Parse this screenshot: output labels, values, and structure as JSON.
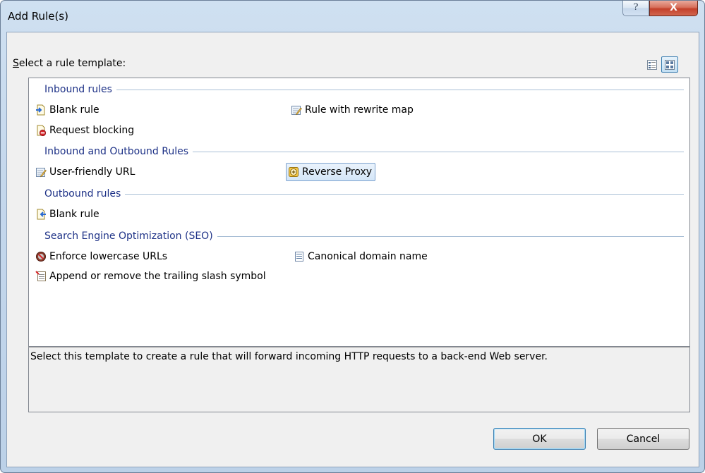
{
  "window": {
    "title": "Add Rule(s)",
    "help_glyph": "?",
    "close_glyph": "X"
  },
  "template_picker": {
    "label_underlined": "S",
    "label_rest": "elect a rule template:",
    "view_modes": [
      "details-view-icon",
      "tiles-view-icon"
    ],
    "active_view": "tiles-view-icon"
  },
  "groups": [
    {
      "header": "Inbound rules",
      "items": [
        {
          "label": "Blank rule",
          "icon": "inbound-blank-rule-icon"
        },
        {
          "label": "Rule with rewrite map",
          "icon": "rewrite-map-icon"
        },
        {
          "label": "Request blocking",
          "icon": "request-blocking-icon"
        }
      ]
    },
    {
      "header": "Inbound and Outbound Rules",
      "items": [
        {
          "label": "User-friendly URL",
          "icon": "user-friendly-url-icon"
        },
        {
          "label": "Reverse Proxy",
          "icon": "reverse-proxy-icon",
          "selected": true
        }
      ]
    },
    {
      "header": "Outbound rules",
      "items": [
        {
          "label": "Blank rule",
          "icon": "outbound-blank-rule-icon"
        }
      ]
    },
    {
      "header": "Search Engine Optimization (SEO)",
      "items": [
        {
          "label": "Enforce lowercase URLs",
          "icon": "lowercase-url-icon"
        },
        {
          "label": "Canonical domain name",
          "icon": "canonical-domain-icon"
        },
        {
          "label": "Append or remove the trailing slash symbol",
          "icon": "trailing-slash-icon"
        }
      ]
    }
  ],
  "description": "Select this template to create a rule that will forward incoming HTTP requests to a back-end Web server.",
  "buttons": {
    "ok": "OK",
    "cancel": "Cancel"
  },
  "colors": {
    "group_header": "#1e3287",
    "selection_border": "#7da2ce",
    "close_button": "#c3402a"
  }
}
